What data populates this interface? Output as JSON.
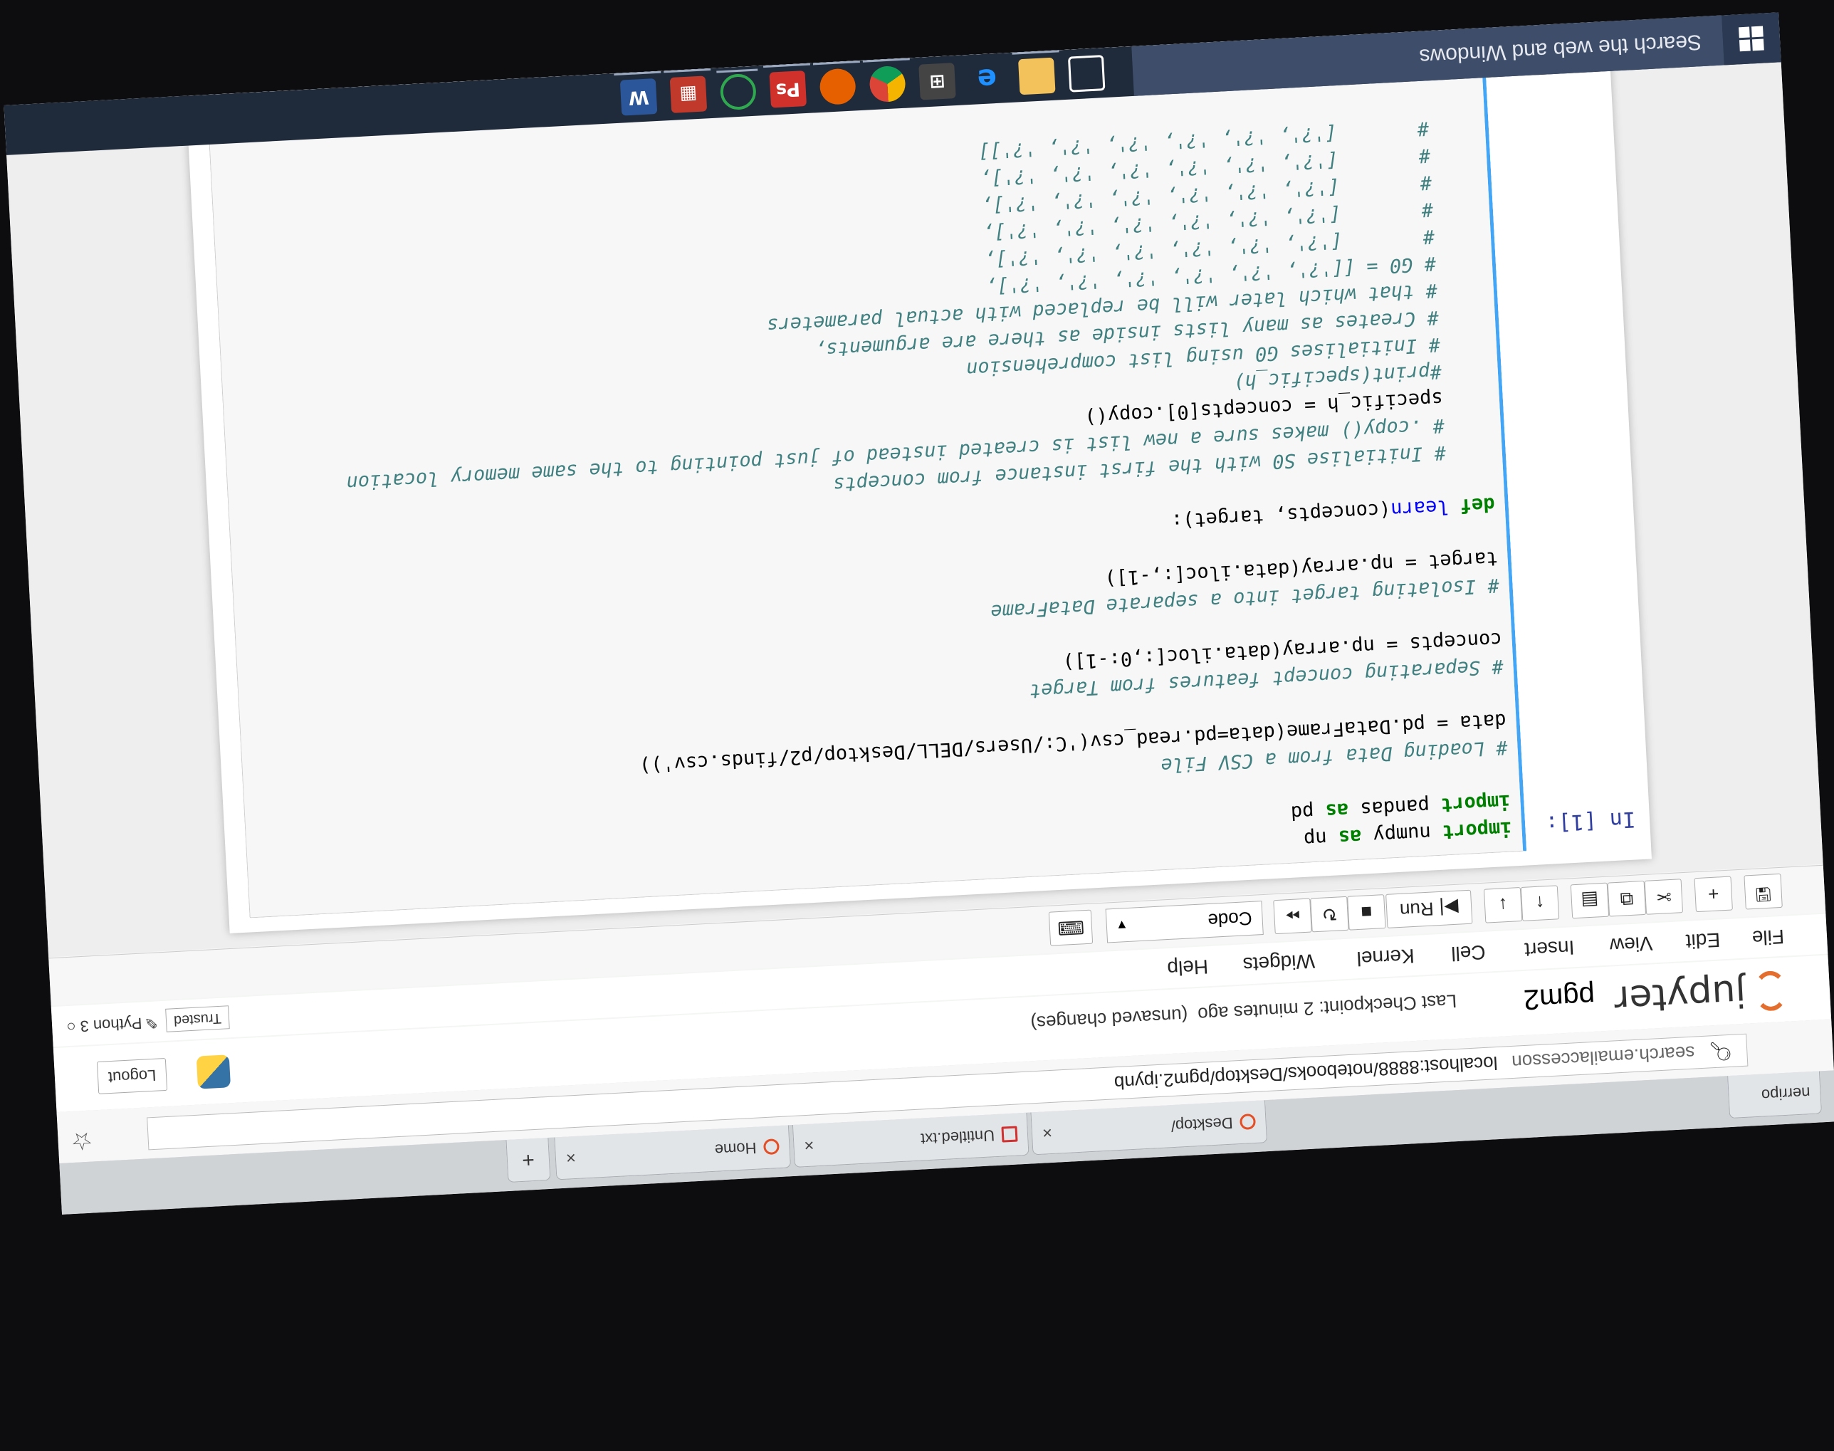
{
  "browser": {
    "tabs": [
      {
        "label": "Desktop/",
        "active": false
      },
      {
        "label": "Untitled.txt",
        "active": false
      },
      {
        "label": "Home",
        "active": false
      }
    ],
    "address_search_term": "search.emailaccesson",
    "address_url": "localhost:8888/notebooks/Desktop/pgm2.ipynb",
    "partial_left_text": "nerripo"
  },
  "jupyter": {
    "logo_text": "jupyter",
    "notebook_name": "pgm2",
    "checkpoint": "Last Checkpoint: 2 minutes ago",
    "unsaved": "(unsaved changes)",
    "logout_label": "Logout",
    "trusted_label": "Trusted",
    "kernel_label": "Python 3",
    "menu": [
      "File",
      "Edit",
      "View",
      "Insert",
      "Cell",
      "Kernel",
      "Widgets",
      "Help"
    ],
    "toolbar": {
      "run_label": "Run",
      "cell_type": "Code"
    }
  },
  "cell": {
    "prompt": "In [1]:",
    "lines": [
      {
        "t": "import numpy as np",
        "c": "kw1"
      },
      {
        "t": "import pandas as pd",
        "c": "kw1"
      },
      {
        "t": "",
        "c": ""
      },
      {
        "t": "# Loading Data from a CSV File",
        "c": "cm"
      },
      {
        "t": "data = pd.DataFrame(data=pd.read_csv('C:/Users/DELL/Desktop/p2/finds.csv'))",
        "c": ""
      },
      {
        "t": "",
        "c": ""
      },
      {
        "t": "# Separating concept features from Target",
        "c": "cm"
      },
      {
        "t": "concepts = np.array(data.iloc[:,0:-1])",
        "c": ""
      },
      {
        "t": "",
        "c": ""
      },
      {
        "t": "# Isolating target into a separate DataFrame",
        "c": "cm"
      },
      {
        "t": "target = np.array(data.iloc[:,-1])",
        "c": ""
      },
      {
        "t": "",
        "c": ""
      },
      {
        "t": "def learn(concepts, target):",
        "c": "def"
      },
      {
        "t": "",
        "c": ""
      },
      {
        "t": "    # Initialise S0 with the first instance from concepts",
        "c": "cm"
      },
      {
        "t": "    # .copy() makes sure a new list is created instead of just pointing to the same memory location",
        "c": "cm"
      },
      {
        "t": "    specific_h = concepts[0].copy()",
        "c": ""
      },
      {
        "t": "    #print(specific_h)",
        "c": "cm"
      },
      {
        "t": "    # Initialises G0 using list comprehension",
        "c": "cm"
      },
      {
        "t": "    # Creates as many lists inside as there are arguments,",
        "c": "cm"
      },
      {
        "t": "    # that which later will be replaced with actual parameters",
        "c": "cm"
      },
      {
        "t": "    # G0 = [['?', '?', '?', '?', '?', '?'],",
        "c": "cm"
      },
      {
        "t": "    #       ['?', '?', '?', '?', '?', '?'],",
        "c": "cm"
      },
      {
        "t": "    #       ['?', '?', '?', '?', '?', '?'],",
        "c": "cm"
      },
      {
        "t": "    #       ['?', '?', '?', '?', '?', '?'],",
        "c": "cm"
      },
      {
        "t": "    #       ['?', '?', '?', '?', '?', '?'],",
        "c": "cm"
      },
      {
        "t": "    #       ['?', '?', '?', '?', '?', '?']]",
        "c": "cm"
      }
    ]
  },
  "taskbar": {
    "search_placeholder": "Search the web and Windows",
    "icons": [
      "task-view-icon",
      "file-explorer-icon",
      "edge-icon",
      "store-icon",
      "chrome-icon",
      "firefox-icon",
      "photoshop-icon",
      "app-circle-icon",
      "app-grid-icon",
      "word-icon"
    ]
  },
  "colors": {
    "jupyter_orange": "#e46e2e",
    "prompt_blue": "#303f9f",
    "selected_cell": "#42a5f5",
    "taskbar": "#1f2a3a"
  }
}
